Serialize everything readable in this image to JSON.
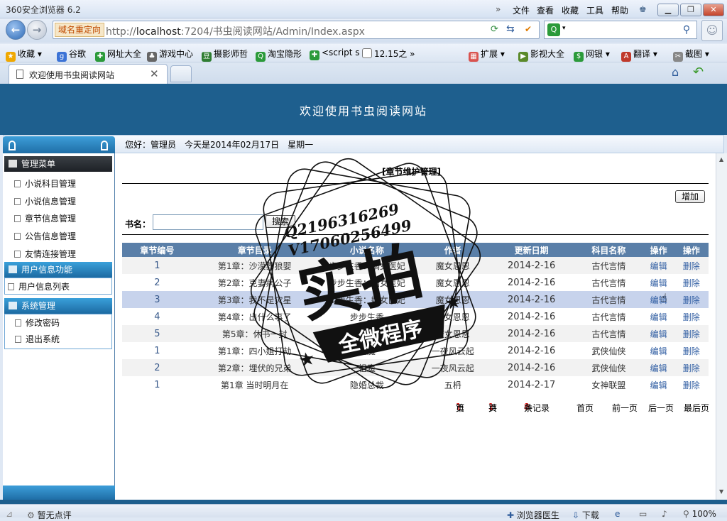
{
  "browser": {
    "title": "360安全浏览器 6.2",
    "menus": [
      "文件",
      "查看",
      "收藏",
      "工具",
      "帮助"
    ],
    "domain_badge": "域名重定向",
    "url_host": "localhost",
    "url_prefix": "http://",
    "url_rest": ":7204/书虫阅读网站/Admin/Index.aspx",
    "favorites": [
      "收藏",
      "谷歌",
      "网址大全",
      "游戏中心",
      "摄影师哲",
      "淘宝隐形",
      "<script s",
      "12.15之"
    ],
    "right_tools": [
      "扩展",
      "影视大全",
      "网银",
      "翻译",
      "截图"
    ],
    "tab_title": "欢迎使用书虫阅读网站",
    "status_left": "暂无点评",
    "status_right": [
      "浏览器医生",
      "下载",
      "100%"
    ]
  },
  "site": {
    "banner_title": "欢迎使用书虫阅读网站",
    "welcome": "您好：管理员　今天是2014年02月17日　星期一"
  },
  "sidebar": {
    "sections": [
      {
        "title": "管理菜单",
        "items": [
          "小说科目管理",
          "小说信息管理",
          "章节信息管理",
          "公告信息管理",
          "友情连接管理"
        ]
      },
      {
        "title": "用户信息功能",
        "items": [
          "用户信息列表"
        ]
      },
      {
        "title": "系统管理",
        "items": [
          "修改密码",
          "退出系统"
        ]
      }
    ]
  },
  "main": {
    "heading": "[章节维护管理]",
    "add_label": "增加",
    "search_label": "书名：",
    "search_value": "",
    "search_button": "搜索",
    "columns": [
      "章节编号",
      "章节目录",
      "小说名称",
      "作者",
      "更新日期",
      "科目名称",
      "操作",
      "操作"
    ],
    "rows": [
      [
        "1",
        "第1章：沙漠葬狼婴",
        "步步生香：嫡女医妃",
        "魔女恩恩",
        "2014-2-16",
        "古代言情",
        "编辑",
        "删除"
      ],
      [
        "2",
        "第2章：克妻病公子",
        "步步生香：嫡女医妃",
        "魔女恩恩",
        "2014-2-16",
        "古代言情",
        "编辑",
        "删除"
      ],
      [
        "3",
        "第3章：我不是灾星",
        "步步生香：嫡女医妃",
        "魔女恩恩",
        "2014-2-16",
        "古代言情",
        "编辑",
        "删除"
      ],
      [
        "4",
        "第4章：出什么事了",
        "步步生香",
        "魔女恩恩",
        "2014-2-16",
        "古代言情",
        "编辑",
        "删除"
      ],
      [
        "5",
        "第5章：休书一封",
        "步步生香",
        "魔女恩恩",
        "2014-2-16",
        "古代言情",
        "编辑",
        "删除"
      ],
      [
        "1",
        "第1章：四小姐打劫",
        "祖魔",
        "一夜风云起",
        "2014-2-16",
        "武侠仙侠",
        "编辑",
        "删除"
      ],
      [
        "2",
        "第2章：埋伏的兄弟",
        "祖魔",
        "一夜风云起",
        "2014-2-16",
        "武侠仙侠",
        "编辑",
        "删除"
      ],
      [
        "1",
        "第1章 当时明月在",
        "隐婚总裁",
        "五枬",
        "2014-2-17",
        "女神联盟",
        "编辑",
        "删除"
      ]
    ],
    "pager": {
      "page_pre": "第",
      "page_num": "1",
      "page_suf": "页",
      "total_pre": "共",
      "total_num": "1",
      "total_suf": "页",
      "rec_pre": "共",
      "rec_num": "8",
      "rec_suf": "条记录",
      "first": "首页",
      "prev": "前一页",
      "next": "后一页",
      "last": "最后页"
    }
  },
  "watermark": {
    "line1": "Q2196316269",
    "line2": "V17060256499",
    "big": "实拍",
    "band": "全微程序"
  },
  "colors": {
    "banner": "#1e5f8e",
    "grid_header": "#5a7fa8",
    "highlight_row": "#c7d3ec",
    "link": "#2f5da2",
    "pager_red": "#d40000"
  }
}
